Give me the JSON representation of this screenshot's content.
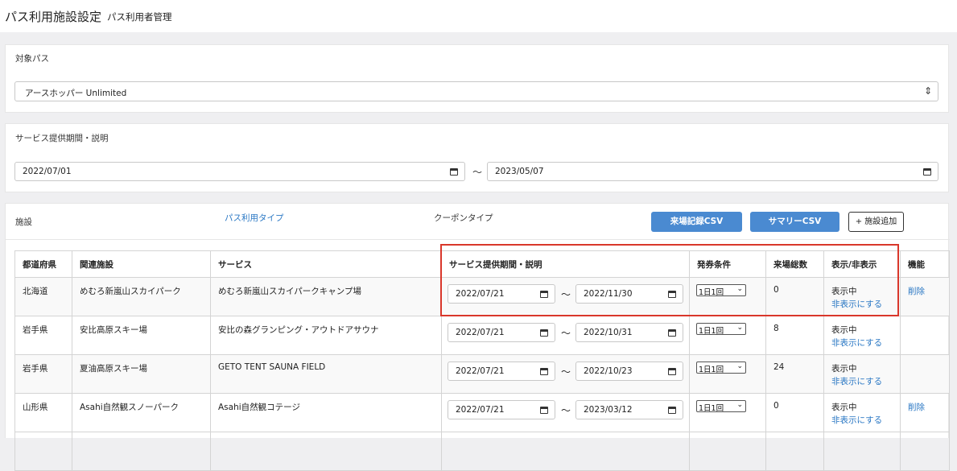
{
  "header": {
    "title": "パス利用施設設定",
    "subtitle": "パス利用者管理"
  },
  "target_pass": {
    "label": "対象パス",
    "selected": "アースホッパー Unlimited"
  },
  "service_period": {
    "label": "サービス提供期間・説明",
    "start": "2022/07/01",
    "separator": "〜",
    "end": "2023/05/07"
  },
  "facilities": {
    "label": "施設",
    "pass_type_link": "パス利用タイプ",
    "coupon_type": "クーポンタイプ",
    "visit_csv_button": "来場記録CSV",
    "summary_csv_button": "サマリーCSV",
    "add_button": "+ 施設追加",
    "columns": [
      "都道府県",
      "関連施設",
      "サービス",
      "サービス提供期間・説明",
      "発券条件",
      "来場総数",
      "表示/非表示",
      "機能"
    ],
    "rows": [
      {
        "prefecture": "北海道",
        "facility": "めむろ新嵐山スカイパーク",
        "service": "めむろ新嵐山スカイパークキャンプ場",
        "start": "2022/07/21",
        "end": "2022/11/30",
        "condition": "1日1回",
        "visits": "0",
        "status": "表示中",
        "toggle": "非表示にする",
        "action": "削除"
      },
      {
        "prefecture": "岩手県",
        "facility": "安比高原スキー場",
        "service": "安比の森グランピング・アウトドアサウナ",
        "start": "2022/07/21",
        "end": "2022/10/31",
        "condition": "1日1回",
        "visits": "8",
        "status": "表示中",
        "toggle": "非表示にする",
        "action": ""
      },
      {
        "prefecture": "岩手県",
        "facility": "夏油高原スキー場",
        "service": "GETO TENT SAUNA FIELD",
        "start": "2022/07/21",
        "end": "2022/10/23",
        "condition": "1日1回",
        "visits": "24",
        "status": "表示中",
        "toggle": "非表示にする",
        "action": ""
      },
      {
        "prefecture": "山形県",
        "facility": "Asahi自然観スノーパーク",
        "service": "Asahi自然観コテージ",
        "start": "2022/07/21",
        "end": "2023/03/12",
        "condition": "1日1回",
        "visits": "0",
        "status": "表示中",
        "toggle": "非表示にする",
        "action": "削除"
      }
    ],
    "date_separator": "〜"
  },
  "colors": {
    "accent": "#4a8ad1",
    "link": "#2b78c4",
    "highlight": "#d9372b"
  }
}
